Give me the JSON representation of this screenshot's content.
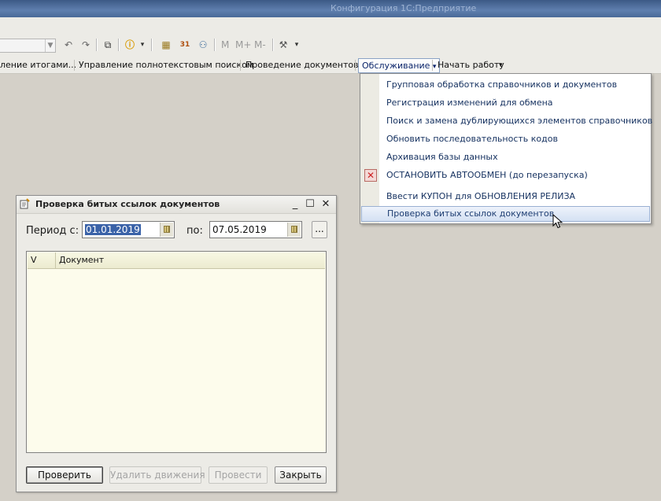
{
  "window": {
    "title": "Конфигурация 1С:Предприятие"
  },
  "toolbar": {
    "memory_buttons": [
      "M",
      "M+",
      "M-"
    ]
  },
  "panel": {
    "items": [
      "ление итогами...",
      "Управление полнотекстовым поиском",
      "Проведение документов...",
      "Обслуживание",
      "Начать работу"
    ],
    "active_dropdown_glyph": "▾"
  },
  "menu": {
    "items": [
      "Групповая обработка справочников и документов",
      "Регистрация изменений для обмена",
      "Поиск и замена дублирующихся элементов справочников",
      "Обновить последовательность кодов",
      "Архивация базы данных",
      "ОСТАНОВИТЬ АВТООБМЕН (до перезапуска)",
      "Ввести КУПОН для ОБНОВЛЕНИЯ РЕЛИЗА",
      "Проверка битых ссылок документов"
    ],
    "highlighted_index": 7
  },
  "dialog": {
    "title": "Проверка битых ссылок документов",
    "period_label": "Период с:",
    "to_label": "по:",
    "date_from": "01.01.2019",
    "date_to": "07.05.2019",
    "dots": "...",
    "grid": {
      "columns": [
        "V",
        "Документ"
      ],
      "rows": []
    },
    "buttons": {
      "check": "Проверить",
      "delete_movements": "Удалить движения",
      "post": "Провести",
      "close": "Закрыть"
    }
  },
  "colors": {
    "desktop": "#d4d0c8",
    "menu_text": "#14305f",
    "highlight": "#d4e1f3",
    "grid_bg": "#fdfcec"
  }
}
